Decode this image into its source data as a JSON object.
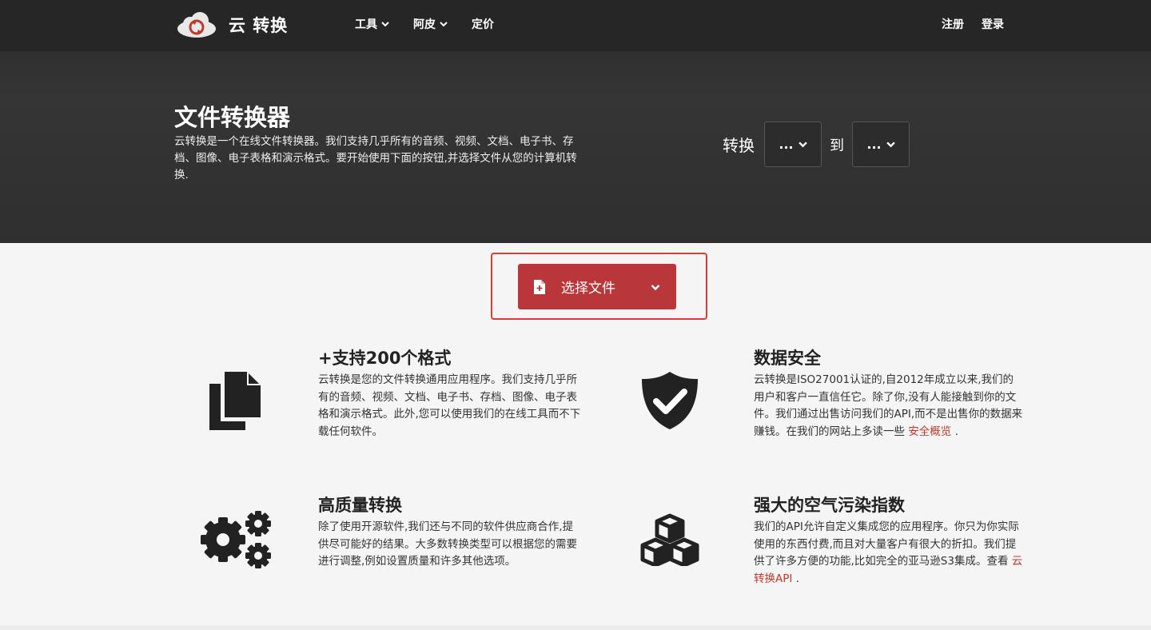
{
  "header": {
    "logo_text": "云 转换",
    "nav": [
      {
        "label": "工具",
        "has_dropdown": true
      },
      {
        "label": "阿皮",
        "has_dropdown": true
      },
      {
        "label": "定价",
        "has_dropdown": false
      }
    ],
    "register": "注册",
    "login": "登录"
  },
  "hero": {
    "title": "文件转换器",
    "description": "云转换是一个在线文件转换器。我们支持几乎所有的音频、视频、文档、电子书、存档、图像、电子表格和演示格式。要开始使用下面的按钮,并选择文件从您的计算机转换.",
    "convert_label": "转换",
    "to_label": "到",
    "from_value": "...",
    "to_value": "..."
  },
  "select_file": {
    "label": "选择文件",
    "accent": "#b9373a",
    "highlight_color": "#e53935"
  },
  "features": [
    {
      "icon": "files-icon",
      "title": "+支持200个格式",
      "text": "云转换是您的文件转换通用应用程序。我们支持几乎所有的音频、视频、文档、电子书、存档、图像、电子表格和演示格式。此外,您可以使用我们的在线工具而不下载任何软件。"
    },
    {
      "icon": "shield-check-icon",
      "title": "数据安全",
      "text": "云转换是ISO27001认证的,自2012年成立以来,我们的用户和客户一直信任它。除了你,没有人能接触到你的文件。我们通过出售访问我们的API,而不是出售你的数据来赚钱。在我们的网站上多读一些",
      "link": "安全概览",
      "suffix": "."
    },
    {
      "icon": "gears-icon",
      "title": "高质量转换",
      "text": "除了使用开源软件,我们还与不同的软件供应商合作,提供尽可能好的结果。大多数转换类型可以根据您的需要进行调整,例如设置质量和许多其他选项。"
    },
    {
      "icon": "cubes-icon",
      "title": "强大的空气污染指数",
      "text": "我们的API允许自定义集成您的应用程序。你只为你实际使用的东西付费,而且对大量客户有很大的折扣。我们提供了许多方便的功能,比如完全的亚马逊S3集成。查看",
      "link": "云转换API",
      "suffix": "."
    }
  ]
}
